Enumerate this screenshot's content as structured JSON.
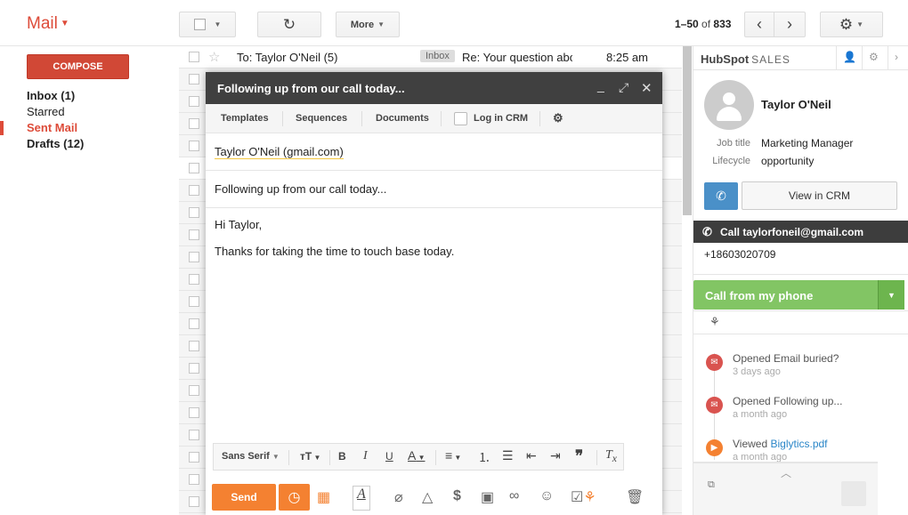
{
  "header": {
    "app_title": "Mail",
    "more_label": "More",
    "pager_range": "1–50",
    "pager_of": "of",
    "pager_total": "833"
  },
  "nav": {
    "compose_label": "COMPOSE",
    "items": [
      {
        "label": "Inbox (1)"
      },
      {
        "label": "Starred"
      },
      {
        "label": "Sent Mail"
      },
      {
        "label": "Drafts (12)"
      }
    ]
  },
  "mail_list": {
    "first_row": {
      "sender": "To: Taylor O'Neil (5)",
      "label": "Inbox",
      "subject": "Re: Your question about",
      "time": "8:25 am"
    }
  },
  "compose": {
    "title": "Following up from our call today...",
    "tools": {
      "templates": "Templates",
      "sequences": "Sequences",
      "documents": "Documents",
      "log_in_crm": "Log in CRM"
    },
    "to": "Taylor O'Neil (gmail.com)",
    "subject": "Following up from our call today...",
    "body": {
      "greeting": "Hi Taylor,",
      "line1": "Thanks for taking the time to touch base today."
    },
    "format": {
      "font": "Sans Serif"
    },
    "send_label": "Send"
  },
  "hubspot": {
    "logo": "HubSpot",
    "logo_suffix": "SALES",
    "contact_name": "Taylor O'Neil",
    "job_title_key": "Job title",
    "job_title": "Marketing Manager",
    "lifecycle_key": "Lifecycle",
    "lifecycle": "opportunity",
    "view_in_crm": "View in CRM",
    "call_bar": "Call taylorfoneil@gmail.com",
    "phone": "+18603020709",
    "call_from_phone": "Call from my phone",
    "timeline": [
      {
        "title": "Opened Email buried?",
        "time": "3 days ago",
        "icon": "email-icon"
      },
      {
        "title": "Opened Following up...",
        "time": "a month ago",
        "icon": "email-icon"
      },
      {
        "title_prefix": "Viewed ",
        "title_link": "Biglytics.pdf",
        "time": "a month ago",
        "icon": "document-view-icon"
      }
    ]
  },
  "colors": {
    "gmail_red": "#dd4b39",
    "compose_button": "#d14836",
    "send_orange": "#f48131",
    "hubspot_green": "#82c564",
    "crm_blue": "#4a90c8"
  }
}
